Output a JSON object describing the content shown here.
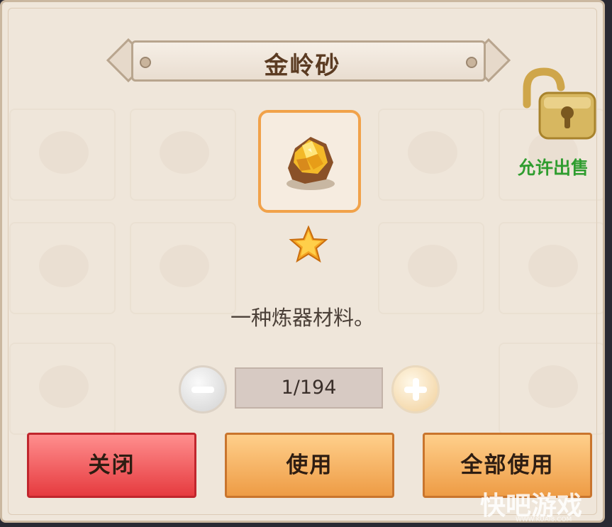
{
  "dialog": {
    "title": "金岭砂",
    "item_icon": "gold-ore-icon",
    "rarity_icon": "star-icon",
    "description": "一种炼器材料。"
  },
  "quantity": {
    "value": "1/194",
    "minus_icon": "minus-icon",
    "plus_icon": "plus-icon"
  },
  "lock": {
    "icon": "unlocked-padlock-icon",
    "label": "允许出售"
  },
  "buttons": {
    "close": "关闭",
    "use": "使用",
    "use_all": "全部使用"
  },
  "watermark": {
    "text": "快吧游戏",
    "sub": "WWW.KUAI8.COM"
  },
  "colors": {
    "panel_bg": "#efe6da",
    "close_red": "#e63b3f",
    "use_orange": "#ee9c45",
    "allow_green": "#2f9d2f",
    "frame_orange": "#f1a24a"
  }
}
